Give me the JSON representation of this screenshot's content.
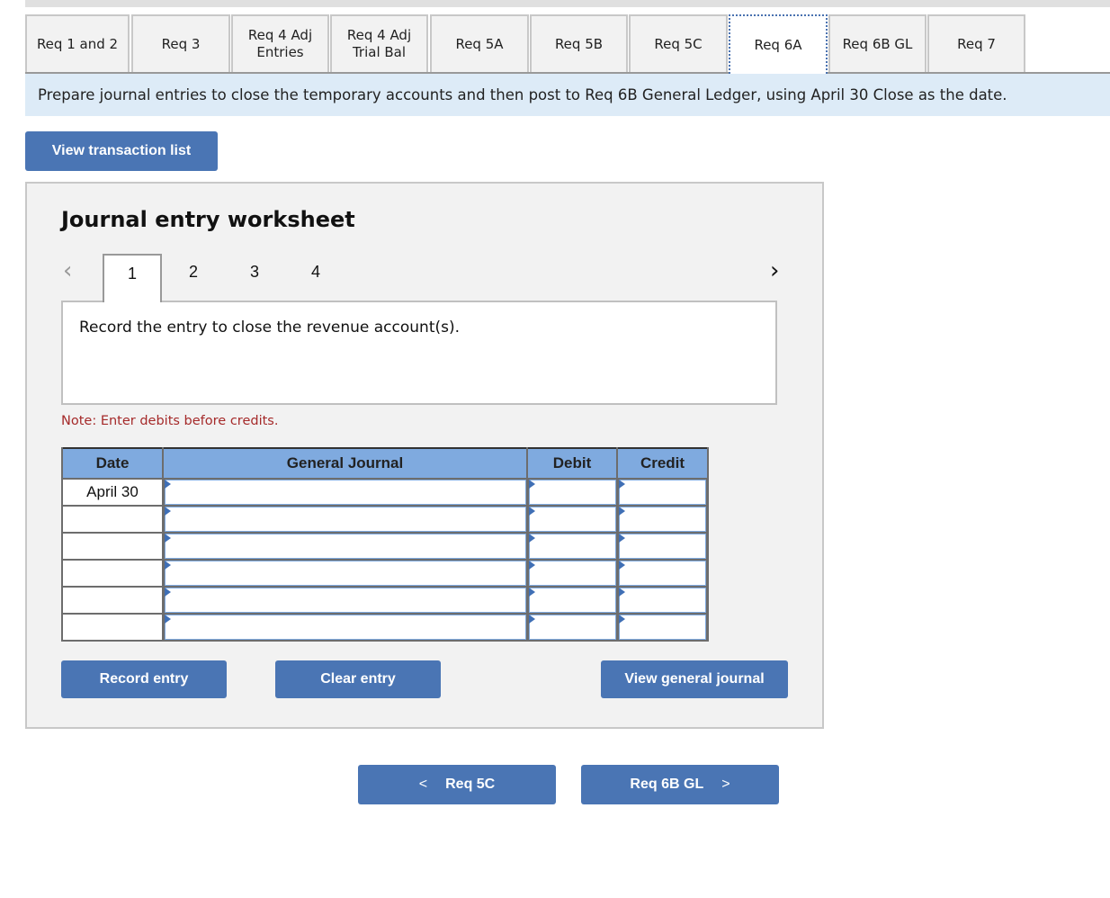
{
  "tabs": [
    {
      "label": "Req 1 and 2",
      "active": false
    },
    {
      "label": "Req 3",
      "active": false
    },
    {
      "label": "Req 4 Adj Entries",
      "active": false
    },
    {
      "label": "Req 4 Adj Trial Bal",
      "active": false
    },
    {
      "label": "Req 5A",
      "active": false
    },
    {
      "label": "Req 5B",
      "active": false
    },
    {
      "label": "Req 5C",
      "active": false
    },
    {
      "label": "Req 6A",
      "active": true
    },
    {
      "label": "Req 6B GL",
      "active": false
    },
    {
      "label": "Req 7",
      "active": false
    }
  ],
  "instruction": "Prepare journal entries to close the temporary accounts and then post to Req 6B General Ledger, using April 30 Close as the date.",
  "view_transaction_list": "View transaction list",
  "worksheet": {
    "title": "Journal entry worksheet",
    "prev_icon": "chevron-left-icon",
    "next_icon": "chevron-right-icon",
    "pages": [
      "1",
      "2",
      "3",
      "4"
    ],
    "active_page": "1",
    "description": "Record the entry to close the revenue account(s).",
    "note": "Note: Enter debits before credits.",
    "table": {
      "headers": {
        "date": "Date",
        "journal": "General Journal",
        "debit": "Debit",
        "credit": "Credit"
      },
      "rows": [
        {
          "date": "April 30",
          "account": "",
          "debit": "",
          "credit": ""
        },
        {
          "date": "",
          "account": "",
          "debit": "",
          "credit": ""
        },
        {
          "date": "",
          "account": "",
          "debit": "",
          "credit": ""
        },
        {
          "date": "",
          "account": "",
          "debit": "",
          "credit": ""
        },
        {
          "date": "",
          "account": "",
          "debit": "",
          "credit": ""
        },
        {
          "date": "",
          "account": "",
          "debit": "",
          "credit": ""
        }
      ]
    },
    "buttons": {
      "record": "Record entry",
      "clear": "Clear entry",
      "view_journal": "View general journal"
    }
  },
  "nav": {
    "prev_label": "Req 5C",
    "next_label": "Req 6B GL",
    "prev_glyph": "<",
    "next_glyph": ">"
  }
}
